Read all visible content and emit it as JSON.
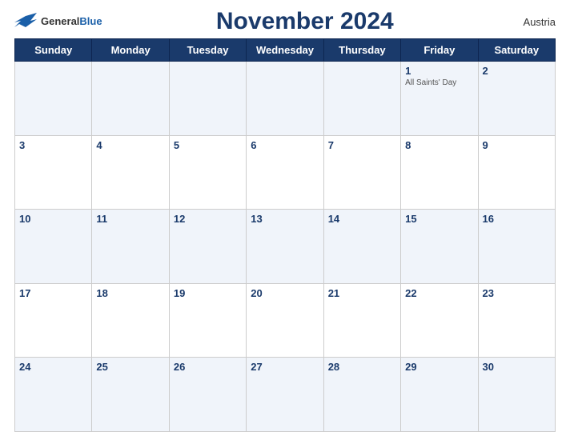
{
  "header": {
    "logo_general": "General",
    "logo_blue": "Blue",
    "month_title": "November 2024",
    "country": "Austria"
  },
  "weekdays": [
    "Sunday",
    "Monday",
    "Tuesday",
    "Wednesday",
    "Thursday",
    "Friday",
    "Saturday"
  ],
  "weeks": [
    [
      {
        "day": "",
        "holiday": ""
      },
      {
        "day": "",
        "holiday": ""
      },
      {
        "day": "",
        "holiday": ""
      },
      {
        "day": "",
        "holiday": ""
      },
      {
        "day": "",
        "holiday": ""
      },
      {
        "day": "1",
        "holiday": "All Saints' Day"
      },
      {
        "day": "2",
        "holiday": ""
      }
    ],
    [
      {
        "day": "3",
        "holiday": ""
      },
      {
        "day": "4",
        "holiday": ""
      },
      {
        "day": "5",
        "holiday": ""
      },
      {
        "day": "6",
        "holiday": ""
      },
      {
        "day": "7",
        "holiday": ""
      },
      {
        "day": "8",
        "holiday": ""
      },
      {
        "day": "9",
        "holiday": ""
      }
    ],
    [
      {
        "day": "10",
        "holiday": ""
      },
      {
        "day": "11",
        "holiday": ""
      },
      {
        "day": "12",
        "holiday": ""
      },
      {
        "day": "13",
        "holiday": ""
      },
      {
        "day": "14",
        "holiday": ""
      },
      {
        "day": "15",
        "holiday": ""
      },
      {
        "day": "16",
        "holiday": ""
      }
    ],
    [
      {
        "day": "17",
        "holiday": ""
      },
      {
        "day": "18",
        "holiday": ""
      },
      {
        "day": "19",
        "holiday": ""
      },
      {
        "day": "20",
        "holiday": ""
      },
      {
        "day": "21",
        "holiday": ""
      },
      {
        "day": "22",
        "holiday": ""
      },
      {
        "day": "23",
        "holiday": ""
      }
    ],
    [
      {
        "day": "24",
        "holiday": ""
      },
      {
        "day": "25",
        "holiday": ""
      },
      {
        "day": "26",
        "holiday": ""
      },
      {
        "day": "27",
        "holiday": ""
      },
      {
        "day": "28",
        "holiday": ""
      },
      {
        "day": "29",
        "holiday": ""
      },
      {
        "day": "30",
        "holiday": ""
      }
    ]
  ]
}
